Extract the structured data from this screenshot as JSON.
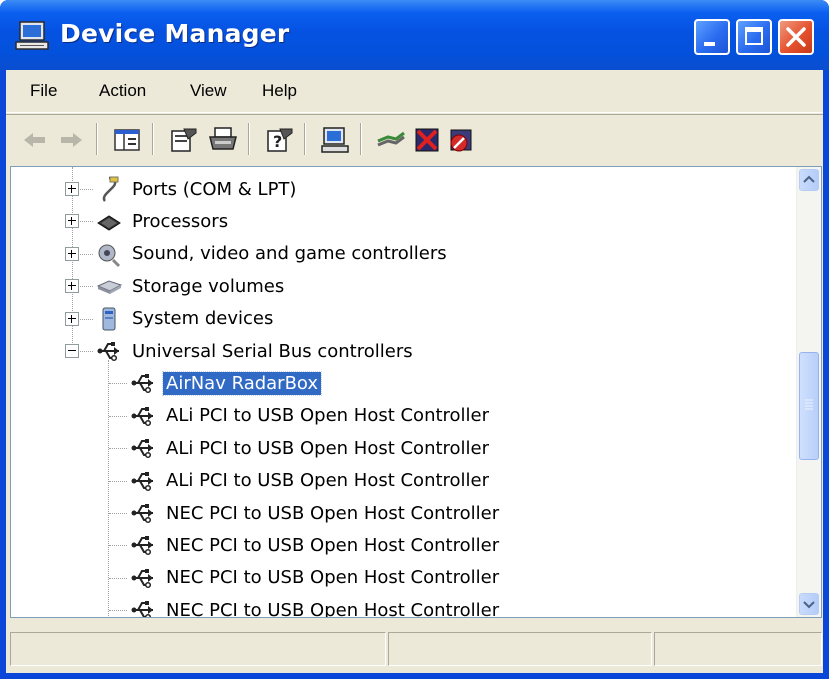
{
  "window": {
    "title": "Device Manager"
  },
  "menu": [
    "File",
    "Action",
    "View",
    "Help"
  ],
  "tree": {
    "items": [
      {
        "label": "Ports (COM & LPT)",
        "icon": "port-icon"
      },
      {
        "label": "Processors",
        "icon": "processor-icon"
      },
      {
        "label": "Sound, video and game controllers",
        "icon": "sound-icon"
      },
      {
        "label": "Storage volumes",
        "icon": "storage-icon"
      },
      {
        "label": "System devices",
        "icon": "system-icon"
      },
      {
        "label": "Universal Serial Bus controllers",
        "icon": "usb-icon"
      }
    ],
    "usb_children": [
      {
        "label": "AirNav RadarBox",
        "selected": true
      },
      {
        "label": "ALi PCI to USB Open Host Controller"
      },
      {
        "label": "ALi PCI to USB Open Host Controller"
      },
      {
        "label": "ALi PCI to USB Open Host Controller"
      },
      {
        "label": "NEC PCI to USB Open Host Controller"
      },
      {
        "label": "NEC PCI to USB Open Host Controller"
      },
      {
        "label": "NEC PCI to USB Open Host Controller"
      },
      {
        "label": "NEC PCI to USB Open Host Controller"
      }
    ]
  },
  "colors": {
    "titlebar": "#0451dc",
    "selection": "#316ac5",
    "face": "#ece9d8"
  }
}
